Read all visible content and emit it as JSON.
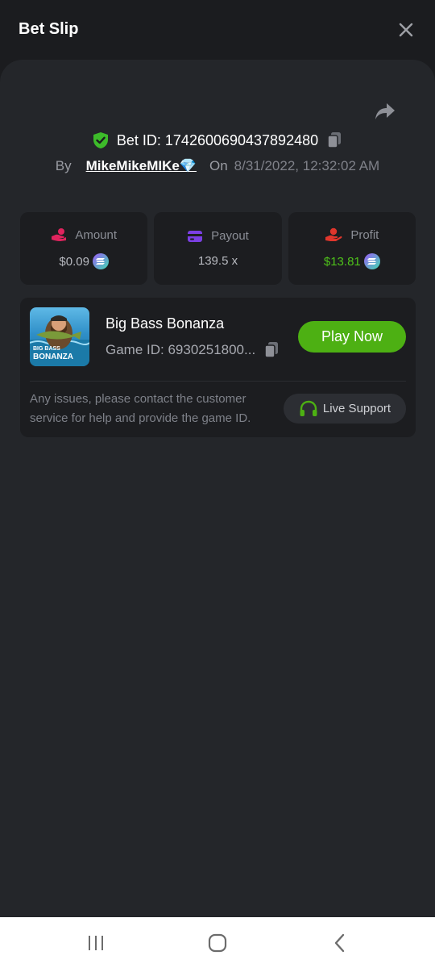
{
  "header": {
    "title": "Bet Slip"
  },
  "bet": {
    "id_label": "Bet ID:",
    "id": "1742600690437892480",
    "by_label": "By",
    "user": "MikeMikeMIKe💎",
    "on_label": "On",
    "date": "8/31/2022, 12:32:02 AM"
  },
  "stats": {
    "amount": {
      "label": "Amount",
      "value": "$0.09"
    },
    "payout": {
      "label": "Payout",
      "value": "139.5 x"
    },
    "profit": {
      "label": "Profit",
      "value": "$13.81"
    }
  },
  "game": {
    "title": "Big Bass Bonanza",
    "id_text": "Game ID: 6930251800...",
    "thumb_line1": "BIG BASS",
    "thumb_line2": "BONANZA",
    "play_label": "Play Now",
    "issue_text": "Any issues, please contact the customer service for help and provide the game ID.",
    "support_label": "Live Support"
  },
  "colors": {
    "accent_green": "#4db013",
    "profit_green": "#4ec11a",
    "shield_green": "#3dbb2a",
    "amount_icon": "#e0245e",
    "payout_icon": "#7b3fe4",
    "profit_icon": "#e0362c"
  },
  "icons": {
    "close": "close-icon",
    "share": "share-icon",
    "shield": "shield-check-icon",
    "copy": "copy-icon",
    "amount": "money-hand-icon",
    "payout": "wallet-card-icon",
    "profit": "profit-hand-icon",
    "coin": "crypto-coin-icon",
    "support": "headset-icon"
  }
}
